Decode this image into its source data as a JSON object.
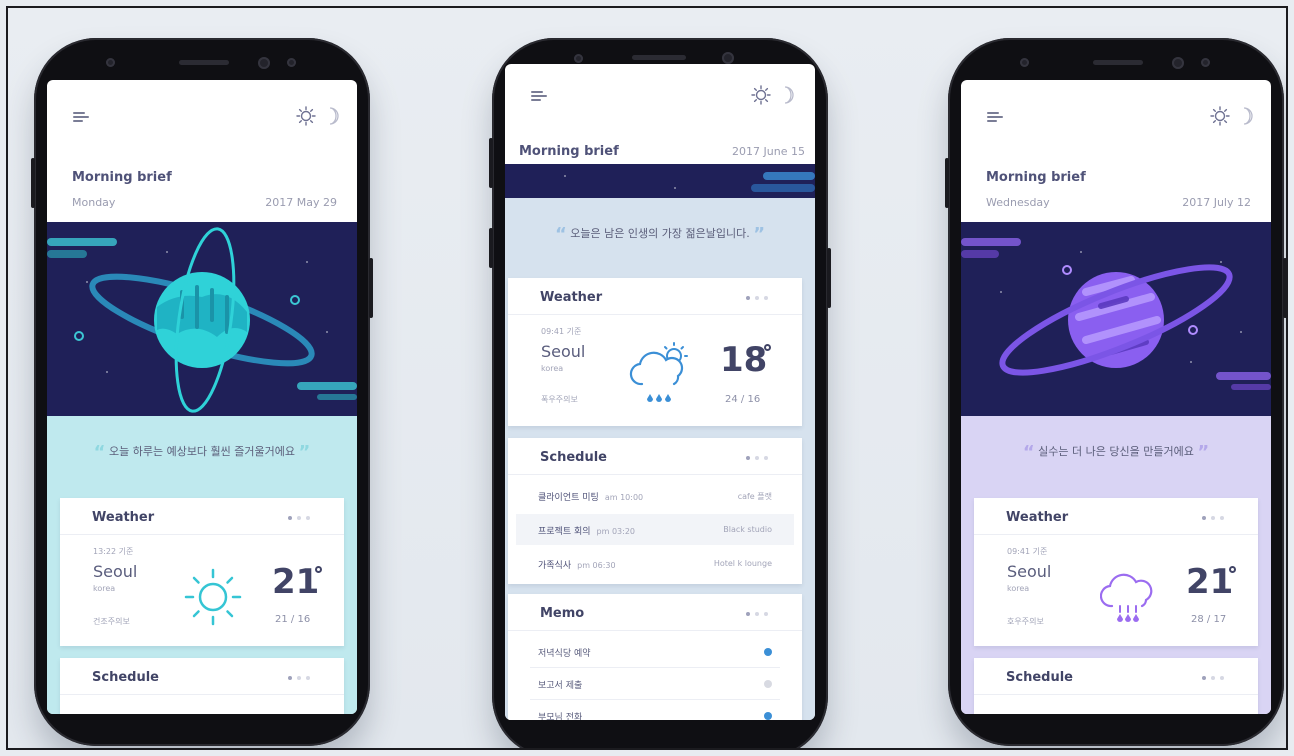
{
  "phones": [
    {
      "brief_title": "Morning brief",
      "day": "Monday",
      "date": "2017 May 29",
      "quote": "오늘 하루는 예상보다 훨씬 즐거울거에요",
      "weather": {
        "title": "Weather",
        "time": "13:22 기준",
        "city": "Seoul",
        "country": "korea",
        "alert": "건조주의보",
        "temp": "21",
        "range": "21 / 16"
      },
      "schedule_title": "Schedule",
      "accent": "#2fd2d8",
      "quote_bg": "#bfe9ee"
    },
    {
      "brief_title": "Morning brief",
      "date": "2017 June 15",
      "quote": "오늘은 남은 인생의 가장 젊은날입니다.",
      "weather": {
        "title": "Weather",
        "time": "09:41 기준",
        "city": "Seoul",
        "country": "korea",
        "alert": "폭우주의보",
        "temp": "18",
        "range": "24 / 16"
      },
      "schedule": {
        "title": "Schedule",
        "rows": [
          {
            "name": "클라이언트 미팅",
            "time": "am 10:00",
            "place": "cafe 플랫"
          },
          {
            "name": "프로젝트 회의",
            "time": "pm 03:20",
            "place": "Black studio"
          },
          {
            "name": "가족식사",
            "time": "pm 06:30",
            "place": "Hotel k lounge"
          }
        ]
      },
      "memo": {
        "title": "Memo",
        "rows": [
          {
            "text": "저녁식당 예약",
            "done": true
          },
          {
            "text": "보고서 제출",
            "done": false
          },
          {
            "text": "부모님 전화",
            "done": true
          }
        ]
      },
      "accent": "#3b8fd6",
      "quote_bg": "#d6e2ee"
    },
    {
      "brief_title": "Morning brief",
      "day": "Wednesday",
      "date": "2017 July 12",
      "quote": "실수는 더 나은 당신을 만들거에요",
      "weather": {
        "title": "Weather",
        "time": "09:41 기준",
        "city": "Seoul",
        "country": "korea",
        "alert": "호우주의보",
        "temp": "21",
        "range": "28 / 17"
      },
      "schedule_title": "Schedule",
      "accent": "#9b6cf0",
      "quote_bg": "#d9d4f4"
    }
  ],
  "icons": {
    "menu": "menu-icon",
    "theme_light": "sun-icon",
    "theme_dark": "moon-icon",
    "weather_sunny": "sun-weather-icon",
    "weather_rain": "rain-cloud-icon",
    "planet": "planet-illustration"
  }
}
